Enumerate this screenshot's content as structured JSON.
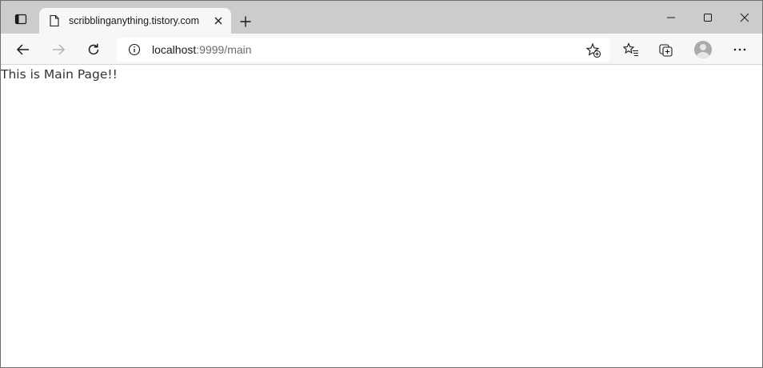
{
  "tab": {
    "title": "scribblinganything.tistory.com"
  },
  "address": {
    "host": "localhost",
    "path": ":9999/main"
  },
  "page": {
    "text": "This is Main Page!!"
  },
  "icons": {
    "tab_actions": "tab-actions-icon",
    "favicon": "page-icon",
    "tab_close": "close-icon",
    "new_tab": "plus-icon",
    "minimize": "minimize-icon",
    "maximize": "maximize-icon",
    "close_window": "close-icon",
    "back": "arrow-left-icon",
    "forward": "arrow-right-icon",
    "refresh": "refresh-icon",
    "site_info": "info-icon",
    "add_favorite": "star-add-icon",
    "favorites": "favorites-icon",
    "collections": "collections-icon",
    "profile": "avatar-icon",
    "more": "more-icon"
  },
  "colors": {
    "tabstrip": "#cccccc",
    "toolbar": "#f7f7f7",
    "page_text": "#333333"
  }
}
